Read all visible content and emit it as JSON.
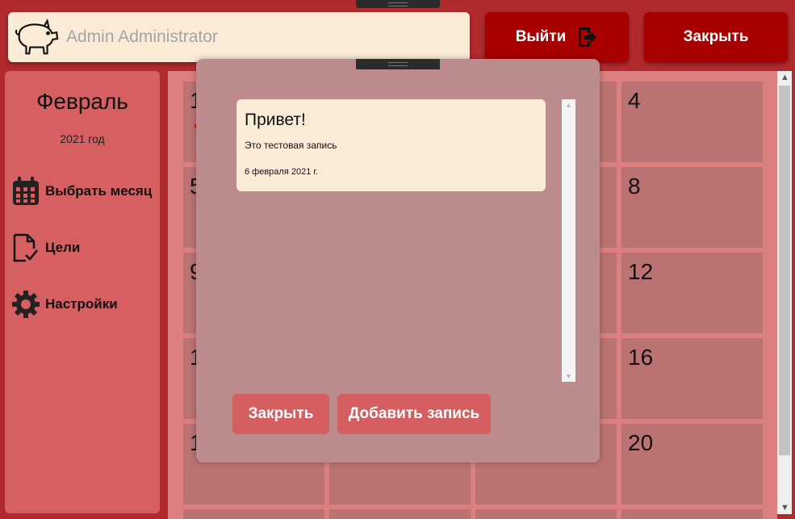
{
  "header": {
    "user_name": "Admin Administrator",
    "logout_label": "Выйти",
    "close_label": "Закрыть"
  },
  "sidebar": {
    "month": "Февраль",
    "year": "2021 год",
    "items": [
      {
        "label": "Выбрать месяц",
        "icon": "calendar-icon"
      },
      {
        "label": "Цели",
        "icon": "document-check-icon"
      },
      {
        "label": "Настройки",
        "icon": "gear-icon"
      }
    ]
  },
  "calendar": {
    "visible_day_labels": [
      "1",
      "4",
      "5",
      "8",
      "9",
      "12",
      "1",
      "16",
      "1",
      "20"
    ]
  },
  "modal": {
    "entries": [
      {
        "title": "Привет!",
        "text": "Это тестовая запись",
        "date": "6 февраля 2021 г."
      }
    ],
    "close_label": "Закрыть",
    "add_label": "Добавить запись"
  },
  "colors": {
    "window_bg": "#b02a2e",
    "accent_button": "#a80000",
    "sidebar_bg": "#d65f61",
    "cell_bg": "#ba7272",
    "card_bg": "#faebd7",
    "modal_bg": "#bc8c8c"
  }
}
